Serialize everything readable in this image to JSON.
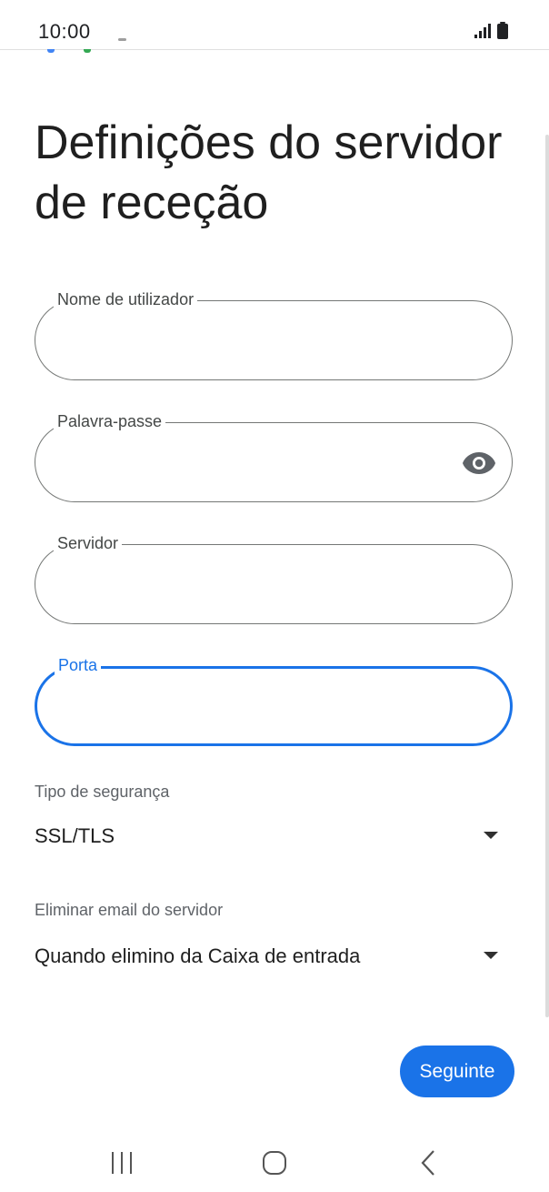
{
  "status_bar": {
    "time": "10:00",
    "icons": [
      "signal-icon",
      "battery-icon"
    ]
  },
  "page": {
    "title": "Definições do servidor de receção"
  },
  "fields": {
    "username": {
      "label": "Nome de utilizador",
      "value": ""
    },
    "password": {
      "label": "Palavra-passe",
      "value": "",
      "toggle_icon": "eye-icon"
    },
    "server": {
      "label": "Servidor",
      "value": ""
    },
    "port": {
      "label": "Porta",
      "value": "",
      "focused": true
    }
  },
  "security": {
    "label": "Tipo de segurança",
    "selected": "SSL/TLS"
  },
  "delete_email": {
    "label": "Eliminar email do servidor",
    "selected": "Quando elimino da Caixa de entrada"
  },
  "actions": {
    "next_label": "Seguinte"
  },
  "nav": {
    "items": [
      "recent-apps-icon",
      "home-icon",
      "back-icon"
    ]
  },
  "colors": {
    "accent": "#1a73e8",
    "outline": "#747775",
    "text": "#1f1f1f"
  }
}
